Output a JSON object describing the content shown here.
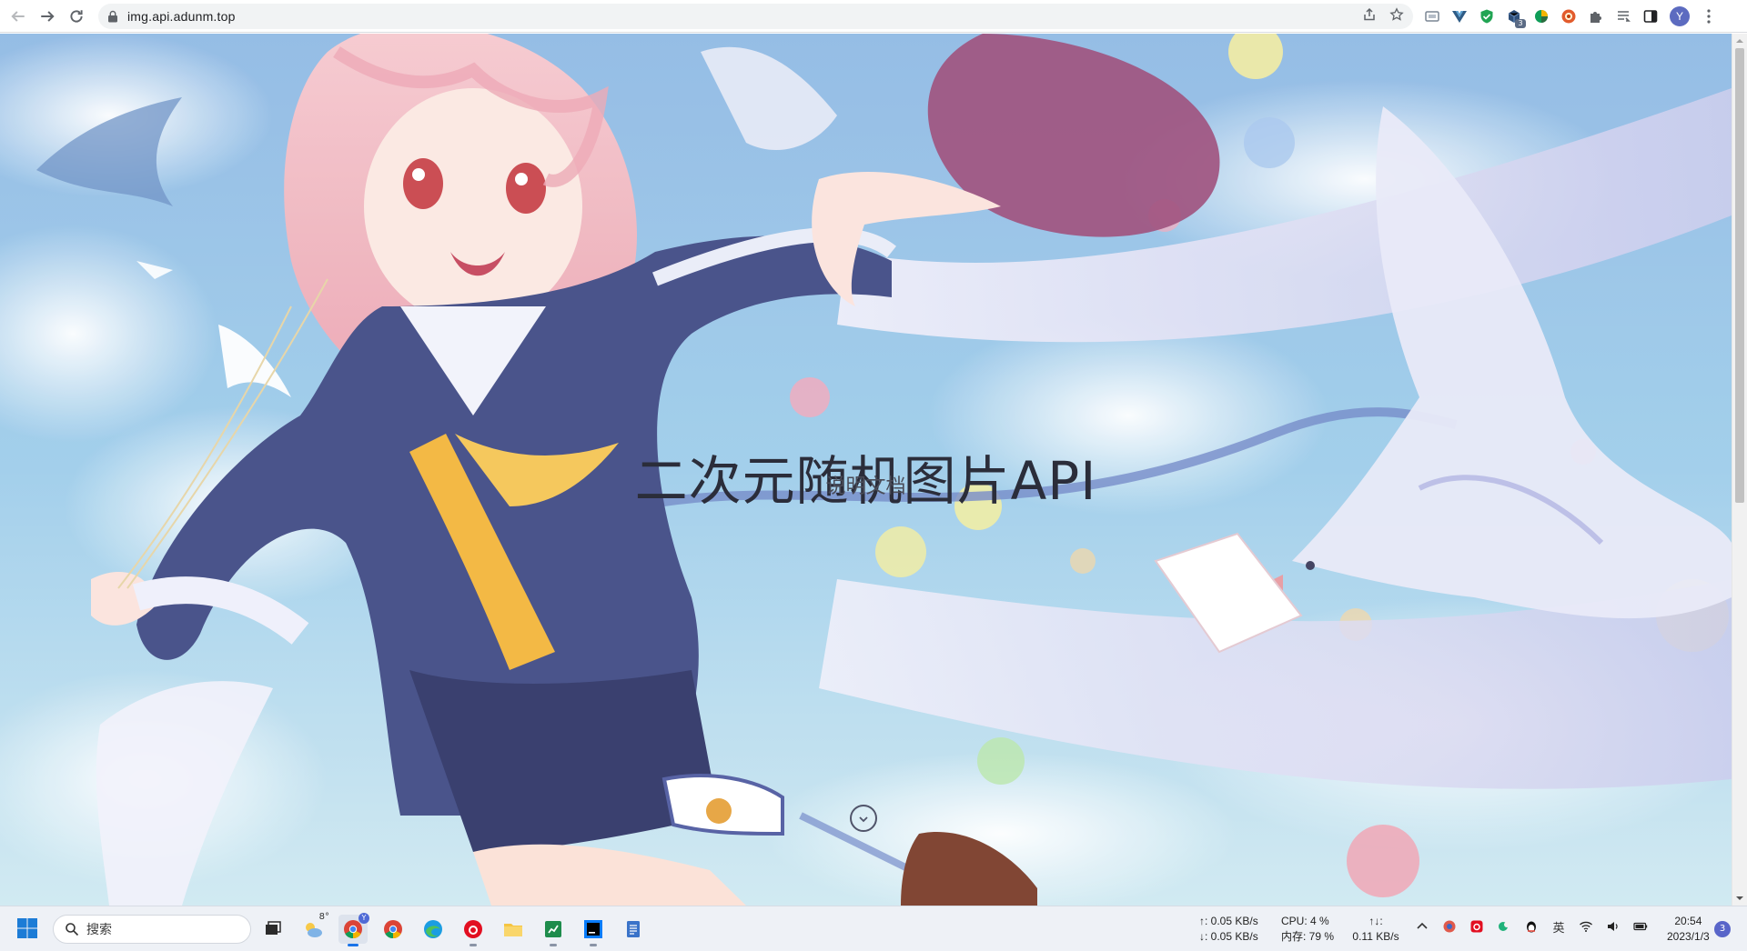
{
  "browser": {
    "url": "img.api.adunm.top",
    "avatar_letter": "Y",
    "extension_badge": "3"
  },
  "page": {
    "title": "二次元随机图片API",
    "doc_link": "说明文档"
  },
  "taskbar": {
    "search_placeholder": "搜索",
    "weather_temp": "8°",
    "chrome_badge": "Y",
    "net_up": "↑: 0.05 KB/s",
    "net_down": "↓: 0.05 KB/s",
    "cpu": "CPU: 4 %",
    "mem": "内存: 79 %",
    "io_arrows": "↑↓:",
    "io_speed": "0.11 KB/s",
    "ime": "英",
    "time": "20:54",
    "date": "2023/1/3",
    "notifications": "3"
  },
  "colors": {
    "sky": "#7fb6e6",
    "title": "#2b2d3a",
    "accent": "#1a73e8"
  }
}
